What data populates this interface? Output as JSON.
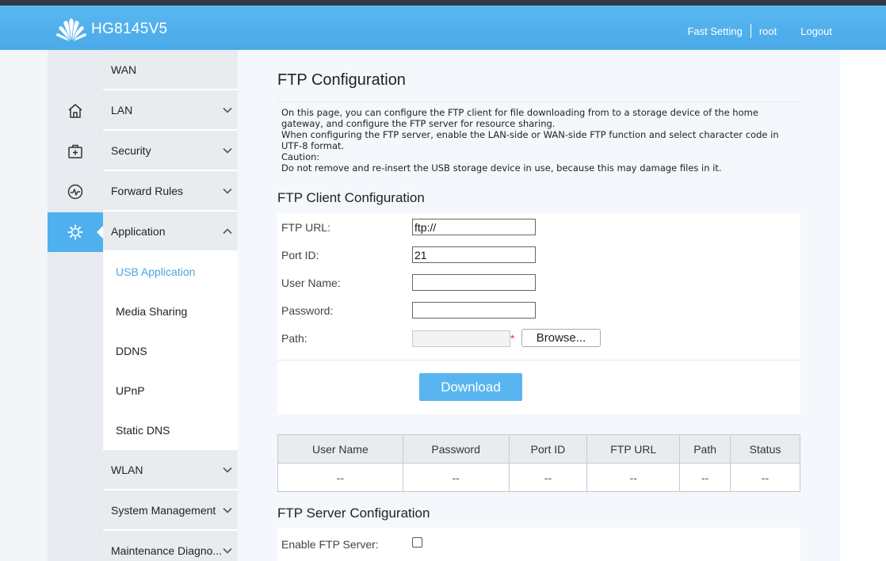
{
  "header": {
    "model": "HG8145V5",
    "nav": [
      "Fast Setting",
      "root",
      "Logout"
    ]
  },
  "sidebar_icons": [
    "home-icon",
    "medical-kit-icon",
    "pulse-icon",
    "gear-icon"
  ],
  "menu": {
    "items": [
      {
        "label": "WAN"
      },
      {
        "label": "LAN"
      },
      {
        "label": "Security"
      },
      {
        "label": "Forward Rules"
      },
      {
        "label": "Application"
      },
      {
        "label": "WLAN"
      },
      {
        "label": "System Management"
      },
      {
        "label": "Maintenance Diagno..."
      }
    ],
    "subitems": [
      "USB Application",
      "Media Sharing",
      "DDNS",
      "UPnP",
      "Static DNS"
    ]
  },
  "page": {
    "title": "FTP Configuration",
    "description": [
      "On this page, you can configure the FTP client for file downloading from to a storage device of the home gateway, and configure the FTP server for resource sharing.",
      "When configuring the FTP server, enable the LAN-side or WAN-side FTP function and select character code in UTF-8 format.",
      "Caution:",
      "Do not remove and re-insert the USB storage device in use, because this may damage files in it."
    ]
  },
  "client": {
    "title": "FTP Client Configuration",
    "fields": [
      {
        "label": "FTP URL:",
        "value": "ftp://"
      },
      {
        "label": "Port ID:",
        "value": "21"
      },
      {
        "label": "User Name:",
        "value": ""
      },
      {
        "label": "Password:",
        "value": ""
      },
      {
        "label": "Path:",
        "value": ""
      }
    ],
    "required_mark": "*",
    "browse_label": "Browse...",
    "download_label": "Download"
  },
  "table": {
    "headers": [
      "User Name",
      "Password",
      "Port ID",
      "FTP URL",
      "Path",
      "Status"
    ],
    "row": [
      "--",
      "--",
      "--",
      "--",
      "--",
      "--"
    ]
  },
  "server": {
    "title": "FTP Server Configuration",
    "enable_label": "Enable FTP Server:",
    "enabled": false
  },
  "colors": {
    "header_blue": "#4fb0ef",
    "active_menu": "#4aa6e0",
    "button_blue": "#58b5f0"
  }
}
